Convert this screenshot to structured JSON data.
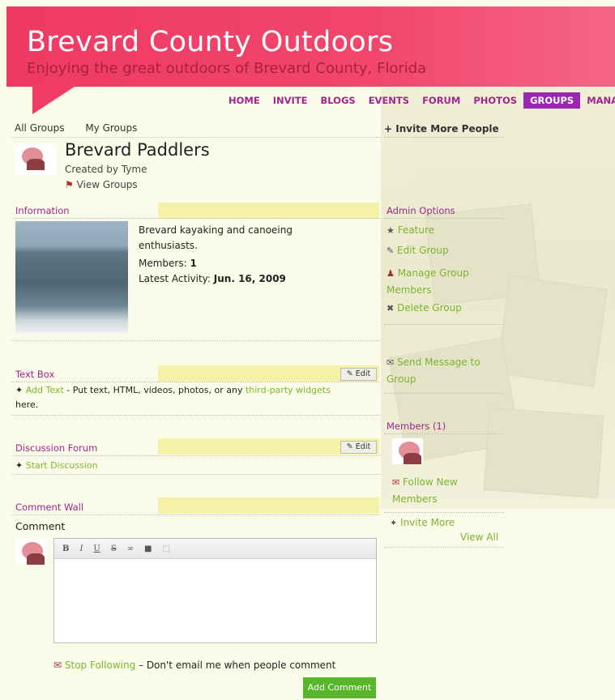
{
  "header": {
    "title": "Brevard County Outdoors",
    "tagline": "Enjoying the great outdoors of Brevard County, Florida"
  },
  "nav": [
    "HOME",
    "INVITE",
    "BLOGS",
    "EVENTS",
    "FORUM",
    "PHOTOS",
    "GROUPS",
    "MANAGE"
  ],
  "nav_active": "GROUPS",
  "subnav": {
    "all": "All Groups",
    "mine": "My Groups",
    "invite": "Invite More People"
  },
  "group": {
    "name": "Brevard Paddlers",
    "created_by": "Created by Tyme",
    "view_groups": "View Groups"
  },
  "information": {
    "heading": "Information",
    "description": "Brevard kayaking and canoeing enthusiasts.",
    "members_label": "Members:",
    "members_value": "1",
    "activity_label": "Latest Activity:",
    "activity_value": "Jun. 16, 2009"
  },
  "textbox": {
    "heading": "Text Box",
    "edit": "Edit",
    "add_text": "Add Text",
    "desc_a": " - Put text, HTML, videos, photos, or any ",
    "third_party": "third-party widgets",
    "desc_b": "here."
  },
  "forum": {
    "heading": "Discussion Forum",
    "edit": "Edit",
    "start": "Start Discussion"
  },
  "wall": {
    "heading": "Comment Wall",
    "comment_label": "Comment",
    "toolbar": [
      "B",
      "I",
      "U",
      "S",
      "∞",
      "■",
      "□"
    ],
    "stop_following": "Stop Following",
    "stop_desc": " – Don't email me when people comment",
    "add_comment": "Add Comment"
  },
  "admin": {
    "heading": "Admin Options",
    "feature": "Feature",
    "edit_group": "Edit Group",
    "manage_members": "Manage Group Members",
    "delete_group": "Delete Group",
    "send_message": "Send Message to Group"
  },
  "members": {
    "heading": "Members (1)",
    "follow": "Follow New Members",
    "invite_more": "Invite More",
    "view_all": "View All"
  },
  "colors": {
    "header": "#ef3c64",
    "accent": "#a0258d",
    "link": "#79b92c",
    "button": "#57b629"
  }
}
